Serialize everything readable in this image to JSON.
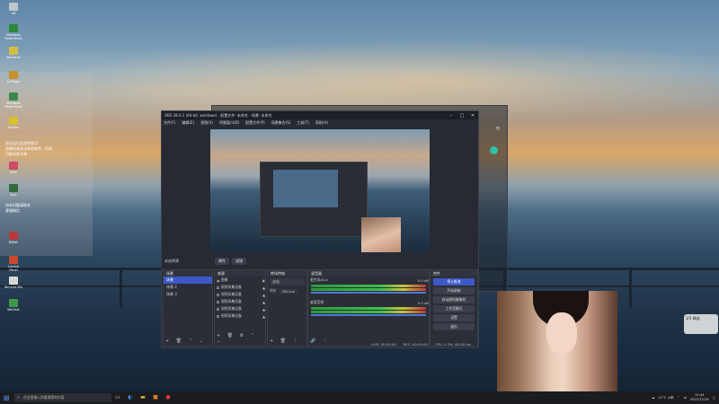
{
  "desktop": {
    "icons": [
      "ldf",
      "Windows PowerShell",
      "WeGame",
      "Ai Plugin",
      "Windows PowerShell",
      "Sticker",
      "Intel",
      "Epic",
      "Bilibili",
      "Control Panel",
      "Recycle Bin",
      "WeChat"
    ],
    "notes": [
      "双击运行此程序即可",
      "直播时请关闭其他软件，否则",
      "可能导致卡顿",
      "如有问题请联系",
      "客服微信"
    ]
  },
  "obs": {
    "title": "OBS 28.0.1 (64-bit, windows) - 配置文件: 未命名 - 场景: 未命名",
    "menu": [
      "文件(F)",
      "编辑(E)",
      "视图(V)",
      "停靠窗口(D)",
      "配置文件(P)",
      "场景集合(S)",
      "工具(T)",
      "帮助(H)"
    ],
    "scene_bar_label": "未选择源",
    "scene_bar_buttons": [
      "属性",
      "滤镜"
    ],
    "scenes": {
      "title": "场景",
      "items": [
        "场景",
        "场景 2",
        "场景 3"
      ]
    },
    "sources": {
      "title": "来源",
      "items": [
        "图像",
        "视频采集设备",
        "视频采集设备",
        "视频采集设备",
        "视频采集设备",
        "视频采集设备"
      ]
    },
    "transitions": {
      "title": "转场特效",
      "type": "淡化",
      "duration_label": "时长",
      "duration": "300 ms"
    },
    "mixer": {
      "title": "混音器",
      "channels": [
        {
          "name": "麦克风/Aux",
          "db": "0.0 dB"
        },
        {
          "name": "桌面音频",
          "db": "0.0 dB"
        }
      ]
    },
    "controls": {
      "title": "控件",
      "buttons": [
        "停止推流",
        "开始录制",
        "启动虚拟摄像机",
        "工作室模式",
        "设置",
        "退出"
      ]
    },
    "status": {
      "live": "LIVE: 00:00:00",
      "rec": "REC: 00:00:00",
      "cpu": "CPU: 0.3%, 60.00 fps"
    }
  },
  "taskbar": {
    "search_placeholder": "在这里输入你要搜索的内容",
    "weather": "11°C 小雨",
    "time": "15:44",
    "date": "2022/12/18"
  },
  "notification": "1/5 精选"
}
